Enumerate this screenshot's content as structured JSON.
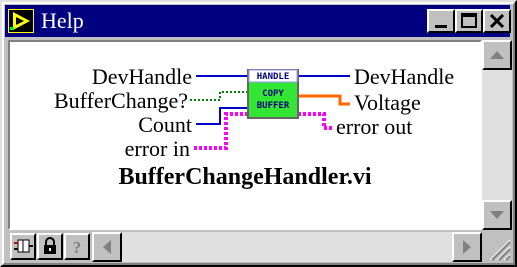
{
  "window": {
    "title": "Help"
  },
  "diagram": {
    "inputs": [
      "DevHandle",
      "BufferChange?",
      "Count",
      "error in"
    ],
    "outputs": [
      "DevHandle",
      "Voltage",
      "error out"
    ],
    "node_text": [
      "HANDLE",
      "COPY",
      "BUFFER"
    ],
    "vi_name": "BufferChangeHandler.vi"
  },
  "colors": {
    "titlebar": "#000080",
    "node_fill": "#33e633",
    "wire_error": "#ff00ff",
    "wire_numeric": "#ff6600",
    "wire_handle": "#0000cc",
    "wire_bool": "#008000"
  },
  "icons": [
    "labview-icon",
    "minimize-icon",
    "maximize-icon",
    "close-icon",
    "scroll-up-icon",
    "scroll-down-icon",
    "scroll-left-icon",
    "scroll-right-icon",
    "lock-icon",
    "help-icon",
    "connector-icon",
    "resize-grip-icon"
  ]
}
